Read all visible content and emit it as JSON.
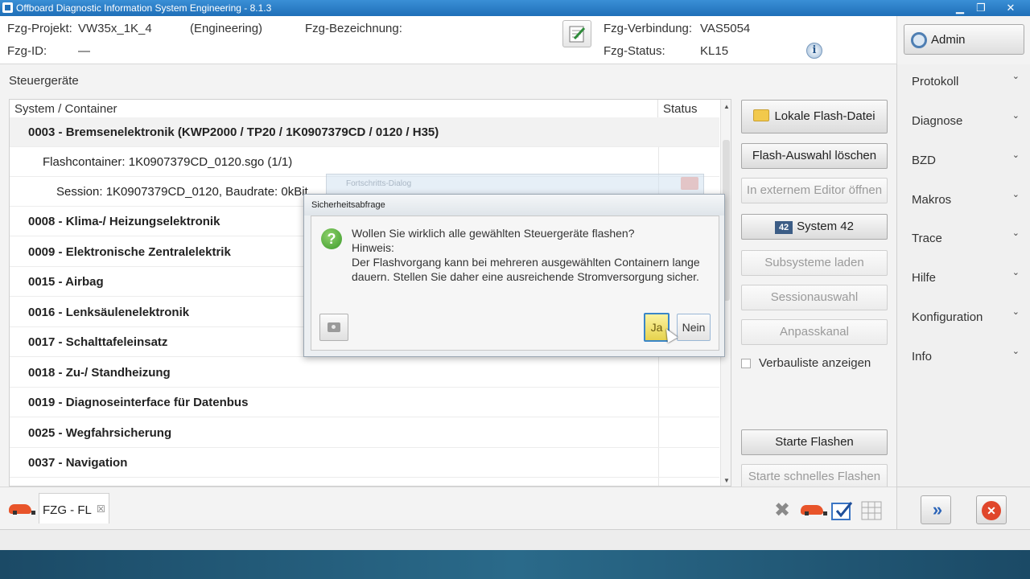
{
  "window": {
    "title": "Offboard Diagnostic Information System Engineering - 8.1.3",
    "min": "▁",
    "max": "❐",
    "close": "✕"
  },
  "header": {
    "projekt_label": "Fzg-Projekt:",
    "projekt_value": "VW35x_1K_4",
    "projekt_mode": "(Engineering)",
    "bezeichnung_label": "Fzg-Bezeichnung:",
    "id_label": "Fzg-ID:",
    "id_value": "—",
    "verbindung_label": "Fzg-Verbindung:",
    "verbindung_value": "VAS5054",
    "status_label": "Fzg-Status:",
    "status_value": "KL15",
    "info_glyph": "i"
  },
  "admin": {
    "label": "Admin"
  },
  "sidebar": {
    "items": [
      {
        "label": "Protokoll"
      },
      {
        "label": "Diagnose"
      },
      {
        "label": "BZD"
      },
      {
        "label": "Makros"
      },
      {
        "label": "Trace"
      },
      {
        "label": "Hilfe"
      },
      {
        "label": "Konfiguration"
      },
      {
        "label": "Info"
      }
    ],
    "chevron": "⌄"
  },
  "main": {
    "section_title": "Steuergeräte",
    "columns": [
      "System / Container",
      "Status"
    ],
    "rows": [
      {
        "text": "0003 - Bremsenelektronik  (KWP2000 / TP20 / 1K0907379CD / 0120 / H35)",
        "level": 0,
        "bold": true
      },
      {
        "text": "Flashcontainer: 1K0907379CD_0120.sgo (1/1)",
        "level": 1,
        "bold": false
      },
      {
        "text": "Session: 1K0907379CD_0120, Baudrate: 0kBit",
        "level": 2,
        "bold": false
      },
      {
        "text": "0008 - Klima-/ Heizungselektronik",
        "level": 0,
        "bold": true
      },
      {
        "text": "0009 - Elektronische Zentralelektrik",
        "level": 0,
        "bold": true
      },
      {
        "text": "0015 - Airbag",
        "level": 0,
        "bold": true
      },
      {
        "text": "0016 - Lenksäulenelektronik",
        "level": 0,
        "bold": true
      },
      {
        "text": "0017 - Schalttafeleinsatz",
        "level": 0,
        "bold": true
      },
      {
        "text": "0018 - Zu-/ Standheizung",
        "level": 0,
        "bold": true
      },
      {
        "text": "0019 - Diagnoseinterface für Datenbus",
        "level": 0,
        "bold": true
      },
      {
        "text": "0025 - Wegfahrsicherung",
        "level": 0,
        "bold": true
      },
      {
        "text": "0037 - Navigation",
        "level": 0,
        "bold": true
      }
    ]
  },
  "actions": {
    "lokale_flash": "Lokale Flash-Datei",
    "flash_loeschen": "Flash-Auswahl löschen",
    "externer_editor": "In externem Editor öffnen",
    "system42": "System 42",
    "system42_badge": "42",
    "subsysteme": "Subsysteme laden",
    "sessionauswahl": "Sessionauswahl",
    "anpasskanal": "Anpasskanal",
    "verbauliste": "Verbauliste anzeigen",
    "starte_flashen": "Starte Flashen",
    "starte_schnell": "Starte schnelles Flashen"
  },
  "tabs": {
    "fzg_label": "FZG - FL",
    "close_glyph": "☒"
  },
  "background_dialog": {
    "title": "Fortschritts-Dialog"
  },
  "dialog": {
    "title": "Sicherheitsabfrage",
    "question": "Wollen Sie wirklich alle gewählten Steuergeräte flashen?",
    "hint_label": "Hinweis:",
    "hint_line1": "Der Flashvorgang kann bei mehreren ausgewählten Containern lange",
    "hint_line2": "dauern. Stellen Sie daher eine ausreichende Stromversorgung sicher.",
    "yes": "Ja",
    "no": "Nein",
    "q_glyph": "?"
  }
}
